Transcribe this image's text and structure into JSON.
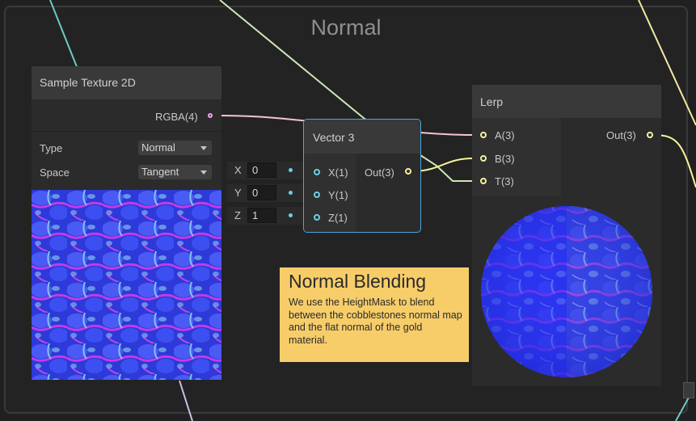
{
  "group": {
    "title": "Normal"
  },
  "sample_texture": {
    "title": "Sample Texture 2D",
    "output_port": "RGBA(4)",
    "properties": [
      {
        "label": "Type",
        "value": "Normal"
      },
      {
        "label": "Space",
        "value": "Tangent"
      }
    ]
  },
  "vector3": {
    "title": "Vector 3",
    "fields": [
      {
        "axis": "X",
        "value": "0"
      },
      {
        "axis": "Y",
        "value": "0"
      },
      {
        "axis": "Z",
        "value": "1"
      }
    ],
    "inputs": [
      "X(1)",
      "Y(1)",
      "Z(1)"
    ],
    "output": "Out(3)"
  },
  "lerp": {
    "title": "Lerp",
    "inputs": [
      "A(3)",
      "B(3)",
      "T(3)"
    ],
    "output": "Out(3)"
  },
  "sticky_note": {
    "title": "Normal Blending",
    "body": "We use the HeightMask to blend between the cobblestones normal map and the flat normal of the gold material."
  },
  "colors": {
    "background": "#202020",
    "node_body": "#2b2b2b",
    "node_header": "#393939",
    "vector3_port": "#6ad0ea",
    "vector4_port": "#f2a2f5",
    "float3_port": "#f6f29c",
    "selection": "#4ea6de",
    "sticky": "#f7cd6a",
    "normal_map_blue": "#3a4cf2",
    "normal_map_magenta": "#b43ae6"
  }
}
